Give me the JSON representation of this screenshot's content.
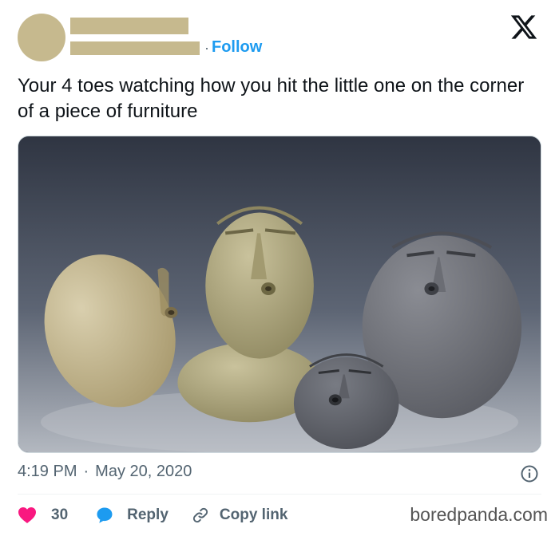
{
  "header": {
    "follow_label": "Follow",
    "separator": "·",
    "redaction_color": "#c6b98e",
    "logo_icon": "x-logo-icon"
  },
  "tweet": {
    "text": "Your 4 toes watching how you hit the little one on the corner of a piece of furniture",
    "time": "4:19 PM",
    "separator": "·",
    "date": "May 20, 2020"
  },
  "actions": {
    "like_count": "30",
    "reply_label": "Reply",
    "copy_label": "Copy link",
    "like_color": "#f91880",
    "reply_color": "#1d9bf0",
    "accent_color": "#1d9bf0"
  },
  "watermark": "boredpanda.com"
}
